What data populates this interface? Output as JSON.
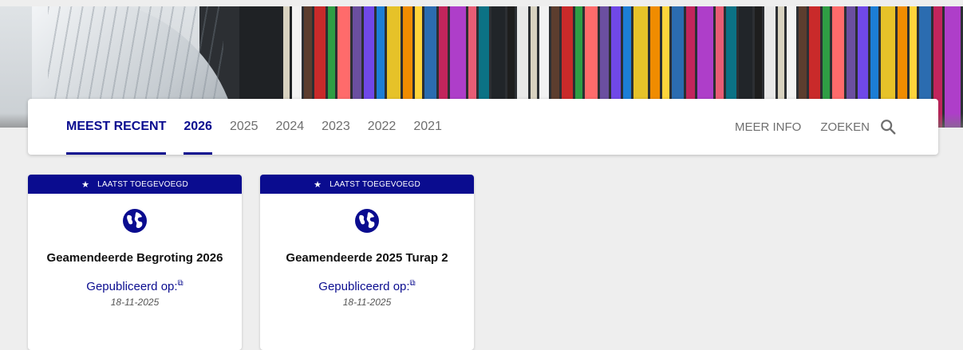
{
  "nav": {
    "tabs": [
      {
        "label": "MEEST RECENT"
      },
      {
        "label": "2026"
      },
      {
        "label": "2025"
      },
      {
        "label": "2024"
      },
      {
        "label": "2023"
      },
      {
        "label": "2022"
      },
      {
        "label": "2021"
      }
    ],
    "meer_info": "MEER INFO",
    "zoeken": "ZOEKEN"
  },
  "cards": [
    {
      "badge": "LAATST TOEGEVOEGD",
      "title": "Geamendeerde Begroting 2026",
      "published_label": "Gepubliceerd op:",
      "date": "18-11-2025"
    },
    {
      "badge": "LAATST TOEGEVOEGD",
      "title": "Geamendeerde 2025 Turap 2",
      "published_label": "Gepubliceerd op:",
      "date": "18-11-2025"
    }
  ],
  "colors": {
    "accent": "#0a0c8f",
    "background": "#eeeeee",
    "muted_text": "#6e6e6e"
  },
  "icons": {
    "card_icon": "globe-icon",
    "search": "search-icon",
    "badge": "star-icon",
    "link": "external-link-icon"
  }
}
